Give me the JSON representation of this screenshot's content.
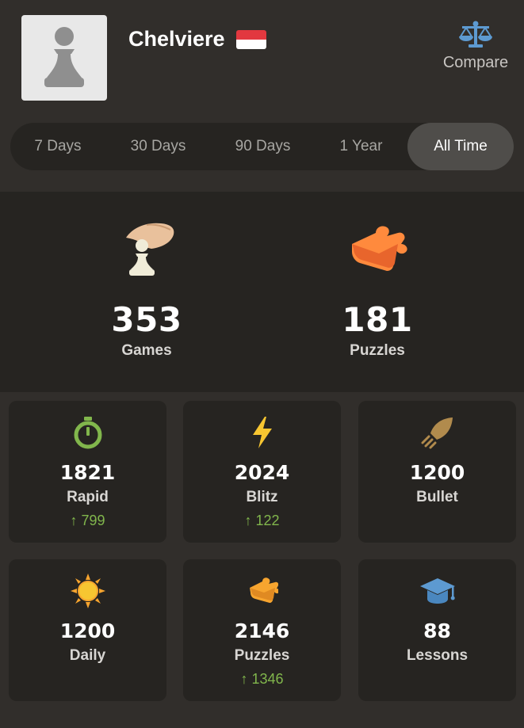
{
  "profile": {
    "username": "Chelviere",
    "compare_label": "Compare"
  },
  "tabs": [
    {
      "label": "7 Days"
    },
    {
      "label": "30 Days"
    },
    {
      "label": "90 Days"
    },
    {
      "label": "1 Year"
    },
    {
      "label": "All Time",
      "active": true
    }
  ],
  "summary": {
    "games": {
      "value": "353",
      "label": "Games"
    },
    "puzzles": {
      "value": "181",
      "label": "Puzzles"
    }
  },
  "stats": [
    {
      "name": "rapid",
      "icon": "stopwatch-icon",
      "value": "1821",
      "label": "Rapid",
      "change": "↑ 799"
    },
    {
      "name": "blitz",
      "icon": "lightning-icon",
      "value": "2024",
      "label": "Blitz",
      "change": "↑ 122"
    },
    {
      "name": "bullet",
      "icon": "rocket-icon",
      "value": "1200",
      "label": "Bullet",
      "change": ""
    },
    {
      "name": "daily",
      "icon": "sun-icon",
      "value": "1200",
      "label": "Daily",
      "change": ""
    },
    {
      "name": "puzzles",
      "icon": "puzzle-icon",
      "value": "2146",
      "label": "Puzzles",
      "change": "↑ 1346"
    },
    {
      "name": "lessons",
      "icon": "graduation-cap-icon",
      "value": "88",
      "label": "Lessons",
      "change": ""
    }
  ],
  "colors": {
    "background": "#312e2b",
    "panel": "#262421",
    "positive": "#81b64c",
    "compare_icon": "#5d9ad1"
  }
}
